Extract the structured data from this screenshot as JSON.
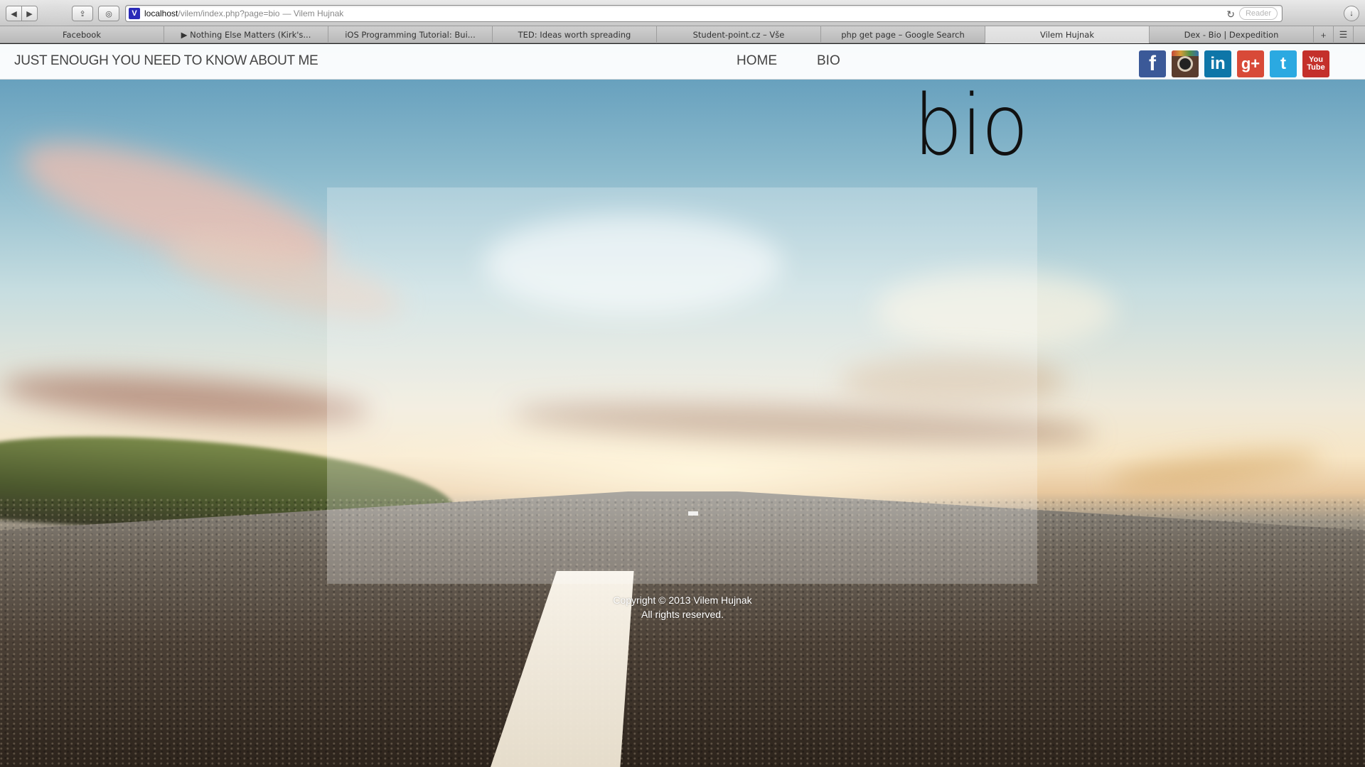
{
  "browser": {
    "url_host": "localhost",
    "url_path": "/vilem/index.php?page=bio",
    "url_title": "— Vilem Hujnak",
    "favicon_letter": "V",
    "reader_label": "Reader",
    "tabs": [
      {
        "label": "Facebook",
        "active": false
      },
      {
        "label": "▶ Nothing Else Matters (Kirk's...",
        "active": false
      },
      {
        "label": "iOS Programming Tutorial: Bui...",
        "active": false
      },
      {
        "label": "TED: Ideas worth spreading",
        "active": false
      },
      {
        "label": "Student-point.cz – Vše",
        "active": false
      },
      {
        "label": "php get page – Google Search",
        "active": false
      },
      {
        "label": "Vilem Hujnak",
        "active": true
      },
      {
        "label": "Dex - Bio | Dexpedition",
        "active": false
      }
    ]
  },
  "site": {
    "tagline": "JUST ENOUGH YOU NEED TO KNOW ABOUT ME",
    "nav": [
      {
        "label": "HOME"
      },
      {
        "label": "BIO"
      }
    ],
    "social": [
      {
        "name": "facebook",
        "glyph": "f",
        "color": "#3b5998"
      },
      {
        "name": "instagram",
        "glyph": "",
        "color": "#5a3d2e"
      },
      {
        "name": "linkedin",
        "glyph": "in",
        "color": "#0e76a8"
      },
      {
        "name": "google-plus",
        "glyph": "g+",
        "color": "#d84a38"
      },
      {
        "name": "twitter",
        "glyph": "t",
        "color": "#2ba9e1"
      },
      {
        "name": "youtube",
        "glyph_top": "You",
        "glyph_bottom": "Tube",
        "color": "#c4302b"
      }
    ],
    "page_title": "bio",
    "footer_line1": "Copyright © 2013 Vilem Hujnak",
    "footer_line2": "All rights reserved."
  }
}
